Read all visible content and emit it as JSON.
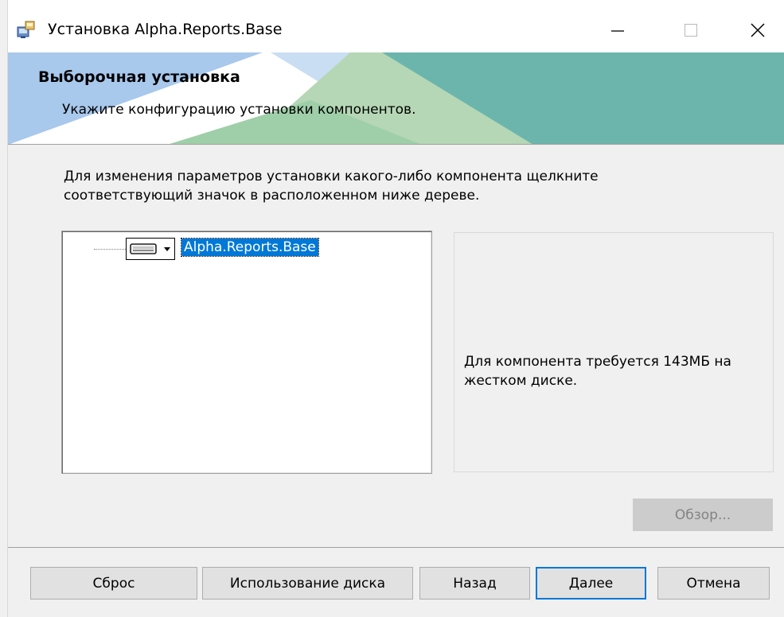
{
  "window": {
    "title": "Установка Alpha.Reports.Base",
    "minimize_icon": "minimize-icon",
    "maximize_icon": "maximize-icon",
    "close_icon": "close-icon"
  },
  "banner": {
    "title": "Выборочная установка",
    "subtitle": "Укажите конфигурацию установки компонентов."
  },
  "instructions": "Для изменения параметров установки какого-либо компонента щелкните соответствующий значок в расположенном ниже дереве.",
  "tree": {
    "items": [
      {
        "label": "Alpha.Reports.Base",
        "icon": "hard-drive-icon",
        "selected": true
      }
    ]
  },
  "info": {
    "text": "Для компонента требуется 143МБ на жестком диске."
  },
  "buttons": {
    "browse": "Обзор...",
    "reset": "Сброс",
    "disk_usage": "Использование диска",
    "back": "Назад",
    "next": "Далее",
    "cancel": "Отмена"
  },
  "colors": {
    "accent": "#0078d7",
    "banner_blue": "#a8c8ec",
    "banner_teal": "#6cb5ad",
    "banner_green": "#b5d7b5"
  }
}
